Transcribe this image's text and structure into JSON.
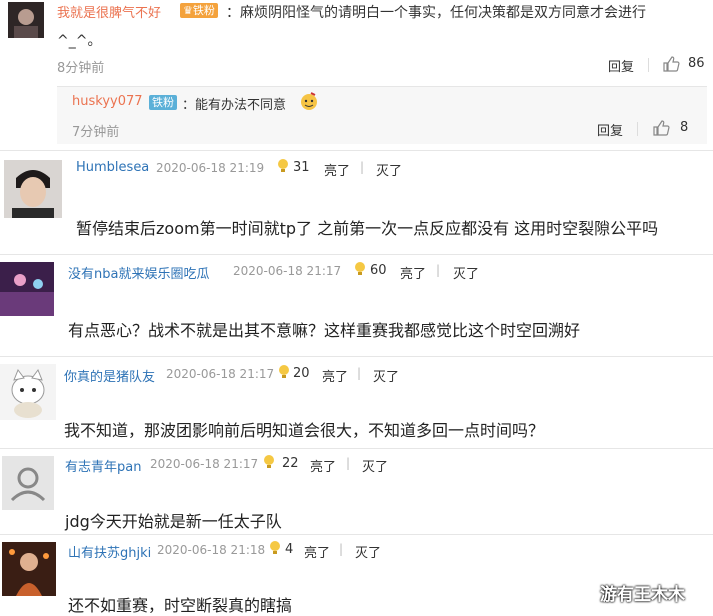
{
  "top_comment": {
    "user": "我就是很脾气不好",
    "badge": "铁粉",
    "text_line1": "：麻烦阴阳怪气的请明白一个事实，任何决策都是双方同意才会进行",
    "text_line2": "^_^。",
    "time": "8分钟前",
    "reply_label": "回复",
    "likes": "86"
  },
  "reply": {
    "user": "huskyy077",
    "badge": "铁粉",
    "text": "：能有办法不同意",
    "time": "7分钟前",
    "reply_label": "回复",
    "likes": "8"
  },
  "comments": [
    {
      "user": "Humblesea",
      "time": "2020-06-18 21:19",
      "count": "31",
      "liang": "亮了",
      "mie": "灭了",
      "text": "暂停结束后zoom第一时间就tp了 之前第一次一点反应都没有 这用时空裂隙公平吗"
    },
    {
      "user": "没有nba就来娱乐圈吃瓜",
      "time": "2020-06-18 21:17",
      "count": "60",
      "liang": "亮了",
      "mie": "灭了",
      "text": "有点恶心？战术不就是出其不意嘛？这样重赛我都感觉比这个时空回溯好"
    },
    {
      "user": "你真的是猪队友",
      "time": "2020-06-18 21:17",
      "count": "20",
      "liang": "亮了",
      "mie": "灭了",
      "text": "我不知道，那波团影响前后明知道会很大，不知道多回一点时间吗？"
    },
    {
      "user": "有志青年pan",
      "time": "2020-06-18 21:17",
      "count": "22",
      "liang": "亮了",
      "mie": "灭了",
      "text": "jdg今天开始就是新一任太子队"
    },
    {
      "user": "山有扶苏ghjki",
      "time": "2020-06-18 21:18",
      "count": "4",
      "liang": "亮了",
      "mie": "灭了",
      "text": "还不如重赛，时空断裂真的瞎搞"
    }
  ],
  "watermark": "游有王木木",
  "colors": {
    "orange_name": "#eb7350",
    "blue_name": "#2e73b6"
  }
}
